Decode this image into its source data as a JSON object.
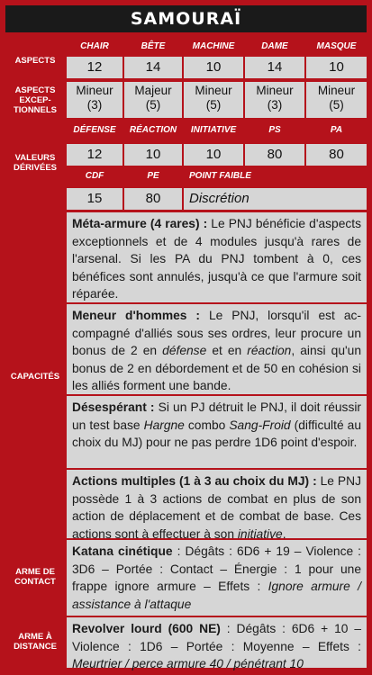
{
  "title": "SAMOURAÏ",
  "labels": {
    "aspects": "ASPECTS",
    "aspects_exc": [
      "ASPECTS",
      "EXCEP-",
      "TIONNELS"
    ],
    "derived": [
      "VALEURS",
      "DÉRIVÉES"
    ],
    "capacites": "CAPACITÉS",
    "contact": [
      "ARME DE",
      "CONTACT"
    ],
    "distance": [
      "ARME À",
      "DISTANCE"
    ]
  },
  "aspects": {
    "headers": [
      "CHAIR",
      "BÊTE",
      "MACHINE",
      "DAME",
      "MASQUE"
    ],
    "values": [
      "12",
      "14",
      "10",
      "14",
      "10"
    ],
    "exceptional": [
      {
        "level": "Mineur",
        "value": "(3)"
      },
      {
        "level": "Majeur",
        "value": "(5)"
      },
      {
        "level": "Mineur",
        "value": "(5)"
      },
      {
        "level": "Mineur",
        "value": "(3)"
      },
      {
        "level": "Mineur",
        "value": "(5)"
      }
    ]
  },
  "derived": {
    "headers1": [
      "DÉFENSE",
      "RÉACTION",
      "INITIATIVE",
      "PS",
      "PA"
    ],
    "values1": [
      "12",
      "10",
      "10",
      "80",
      "80"
    ],
    "headers2": [
      "CDF",
      "PE",
      "POINT FAIBLE"
    ],
    "values2": [
      "15",
      "80",
      "Discrétion"
    ]
  },
  "capacites": [
    {
      "name": "Méta-armure (4 rares) :",
      "parts": [
        {
          "t": " Le PNJ bénéficie d'as­pects exceptionnels et de 4 modules jusqu'à rares de l'arsenal. Si les PA du PNJ tombent à 0, ces bénéfices sont annulés, jusqu'à ce que l'ar­mure soit réparée.",
          "i": false
        }
      ]
    },
    {
      "name": "Meneur d'hommes :",
      "parts": [
        {
          "t": " Le PNJ, lorsqu'il est ac­compagné d'alliés sous ses ordres, leur procure un bonus de 2 en ",
          "i": false
        },
        {
          "t": "défense",
          "i": true
        },
        {
          "t": " et en ",
          "i": false
        },
        {
          "t": "réaction",
          "i": true
        },
        {
          "t": ", ainsi qu'un bonus de 2 en débordement et de 50 en cohésion si les alliés forment une bande.",
          "i": false
        }
      ]
    },
    {
      "name": "Désespérant :",
      "parts": [
        {
          "t": " Si un PJ détruit le PNJ, il doit réussir un test base ",
          "i": false
        },
        {
          "t": "Hargne",
          "i": true
        },
        {
          "t": " combo ",
          "i": false
        },
        {
          "t": "Sang-Froid",
          "i": true
        },
        {
          "t": " (difficulté au choix du MJ) pour ne pas perdre 1D6 point d'espoir.",
          "i": false
        }
      ]
    },
    {
      "name": "Actions multiples (1 à 3 au choix du MJ) :",
      "parts": [
        {
          "t": " Le PNJ possède 1 à 3 actions de combat en plus de son action de déplacement et de combat de base. Ces actions sont à effectuer à son ",
          "i": false
        },
        {
          "t": "initiative",
          "i": true
        },
        {
          "t": ".",
          "i": false
        }
      ]
    }
  ],
  "contact": {
    "name": "Katana cinétique",
    "parts": [
      {
        "t": " : Dégâts : 6D6 + 19 – Vio­lence : 3D6 – Portée : Contact – Énergie : 1 pour une frappe ignore armure – Effets : ",
        "i": false
      },
      {
        "t": "Ignore armure / assistance à l'attaque",
        "i": true
      }
    ]
  },
  "distance": {
    "name": "Revolver lourd (600 NE)",
    "parts": [
      {
        "t": " : Dégâts : 6D6 + 10 – Violence : 1D6 – Portée : Moyenne – Effets : ",
        "i": false
      },
      {
        "t": "Meurtrier / perce armure 40 / pénétrant 10",
        "i": true
      }
    ]
  },
  "colors": {
    "red": "#b5121b",
    "dark": "#1a1a1a",
    "cell": "#d6d6d6"
  }
}
